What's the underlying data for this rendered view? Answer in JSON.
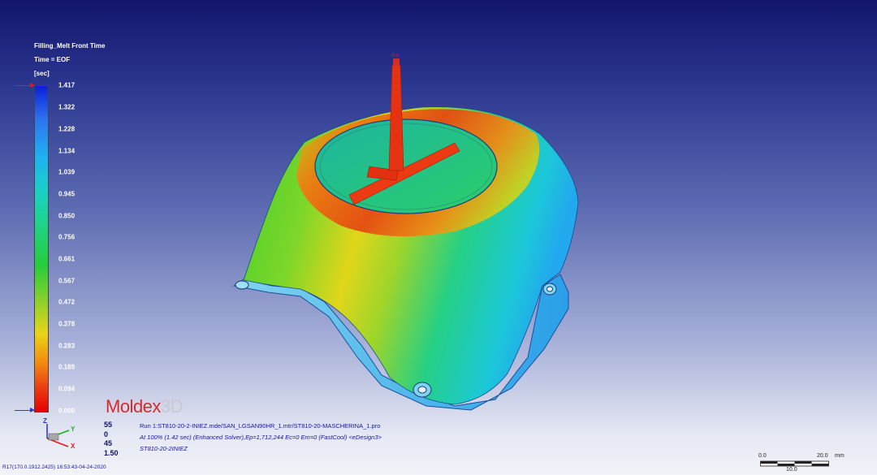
{
  "legend": {
    "title": "Filling_Melt Front Time",
    "time": "Time = EOF",
    "unit": "[sec]",
    "ticks": [
      "1.417",
      "1.322",
      "1.228",
      "1.134",
      "1.039",
      "0.945",
      "0.850",
      "0.756",
      "0.661",
      "0.567",
      "0.472",
      "0.378",
      "0.283",
      "0.189",
      "0.094",
      "0.000"
    ]
  },
  "brand": {
    "logo_main": "Moldex",
    "logo_suffix": "3D"
  },
  "view_numbers": [
    "55",
    "0",
    "45",
    "1.50"
  ],
  "run_info": {
    "line1": "Run 1:ST810-20-2-INIEZ.mde/SAN_LGSAN90HR_1.mtr/ST810-20-MASCHERINA_1.pro",
    "line2": "At 100% (1.42 sec) (Enhanced Solver),Ep=1,712,244 Ec=0 Em=0 (FastCool) <eDesign3>",
    "line3": "ST810-20-2INIEZ"
  },
  "footer": "R17(170.0.1912.2425) 16:53:43-04-24-2020",
  "axes": {
    "z": "Z",
    "y": "Y",
    "x": "X"
  },
  "gate_label": "Em",
  "scale_bar": {
    "left": "0.0",
    "right": "20.0",
    "unit": "mm",
    "mid": "10.0"
  },
  "colors": {
    "accent_red": "#d42b2b",
    "marker_red": "#e11b1b",
    "marker_blue": "#1f3fd8"
  }
}
